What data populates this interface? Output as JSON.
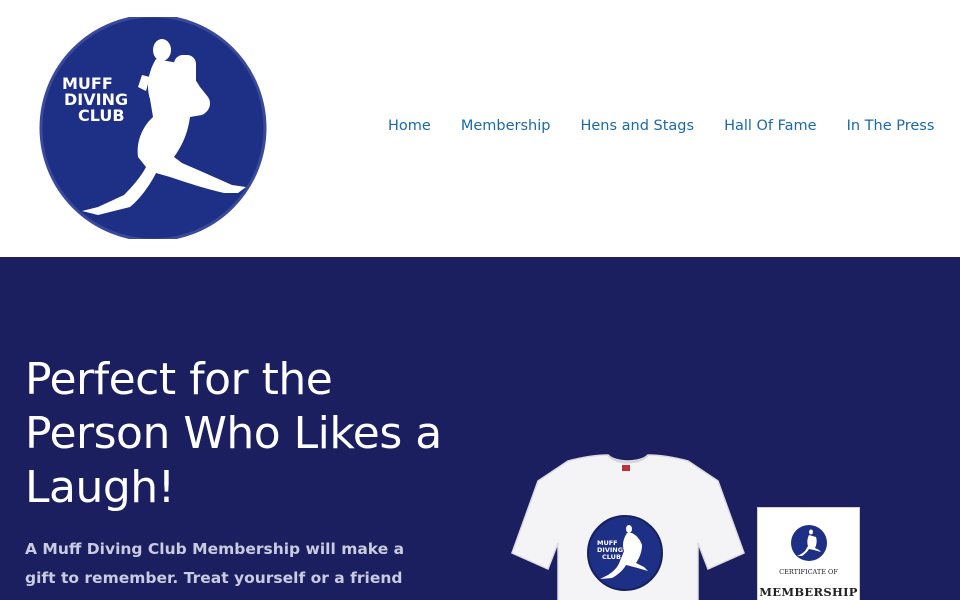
{
  "brand": {
    "logo_text": [
      "MUFF",
      "DIVING",
      "CLUB"
    ],
    "colors": {
      "navy": "#1b1f5f",
      "logo_blue": "#1e2f86",
      "link": "#1a6aa8"
    }
  },
  "nav": {
    "items": [
      {
        "label": "Home"
      },
      {
        "label": "Membership"
      },
      {
        "label": "Hens and Stags"
      },
      {
        "label": "Hall Of Fame"
      },
      {
        "label": "In The Press"
      }
    ]
  },
  "hero": {
    "title": "Perfect for the Person Who Likes a Laugh!",
    "text": "A Muff Diving Club Membership will make a gift to remember. Treat yourself or a friend as"
  },
  "products": {
    "tshirt_logo_text": [
      "MUFF",
      "DIVING",
      "CLUB"
    ],
    "certificate": {
      "subtitle": "CERTIFICATE OF",
      "title": "MEMBERSHIP"
    }
  }
}
